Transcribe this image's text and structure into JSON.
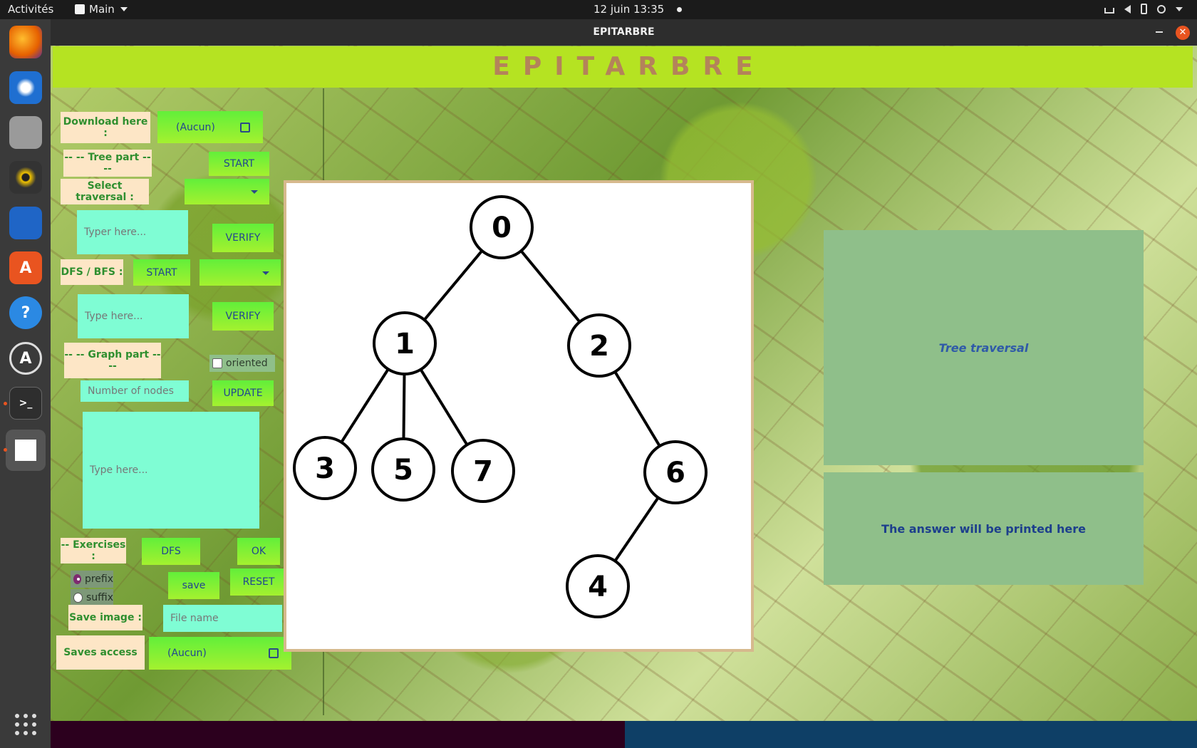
{
  "topbar": {
    "activities": "Activités",
    "app_menu": "Main",
    "datetime": "12 juin  13:35"
  },
  "window": {
    "title": "EPITARBRE",
    "close_symbol": "✕"
  },
  "header": {
    "title": "EPITARBRE"
  },
  "left_panel": {
    "download_label": "Download here :",
    "download_file_value": "(Aucun)",
    "tree_part_label": "-- -- Tree part -- --",
    "tree_start": "START",
    "select_traversal_label": "Select traversal :",
    "traversal_input_placeholder": "Typer here...",
    "verify_1": "VERIFY",
    "dfs_bfs_label": "DFS / BFS :",
    "dfs_start": "START",
    "dfs_input_placeholder": "Type here...",
    "verify_2": "VERIFY",
    "graph_part_label": "-- -- Graph part -- --",
    "oriented_label": "oriented",
    "nodes_placeholder": "Number of nodes",
    "update": "UPDATE",
    "graph_text_placeholder": "Type here...",
    "exercises_label": "-- Exercises :",
    "dfs_button": "DFS",
    "ok_button": "OK",
    "prefix_label": "prefix",
    "suffix_label": "suffix",
    "save_button": "save",
    "reset_button": "RESET",
    "save_image_label": "Save image :",
    "file_name_placeholder": "File name",
    "saves_access_label": "Saves access",
    "saves_file_value": "(Aucun)"
  },
  "tree": {
    "nodes": [
      {
        "id": "0",
        "label": "0"
      },
      {
        "id": "1",
        "label": "1"
      },
      {
        "id": "2",
        "label": "2"
      },
      {
        "id": "3",
        "label": "3"
      },
      {
        "id": "5",
        "label": "5"
      },
      {
        "id": "7",
        "label": "7"
      },
      {
        "id": "6",
        "label": "6"
      },
      {
        "id": "4",
        "label": "4"
      }
    ],
    "edges": [
      [
        "0",
        "1"
      ],
      [
        "0",
        "2"
      ],
      [
        "1",
        "3"
      ],
      [
        "1",
        "5"
      ],
      [
        "1",
        "7"
      ],
      [
        "2",
        "6"
      ],
      [
        "6",
        "4"
      ]
    ]
  },
  "right_panel": {
    "traversal_title": "Tree traversal",
    "answer_text": "The answer will be printed here"
  },
  "colors": {
    "header_bg": "#b5e322",
    "header_text": "#b4835a",
    "button_green": "#62ef3a",
    "field_aqua": "#7ffdd4",
    "label_bg": "#fde6c6",
    "label_text": "#2f8f2f",
    "panel_bg": "#8fbf8a"
  }
}
